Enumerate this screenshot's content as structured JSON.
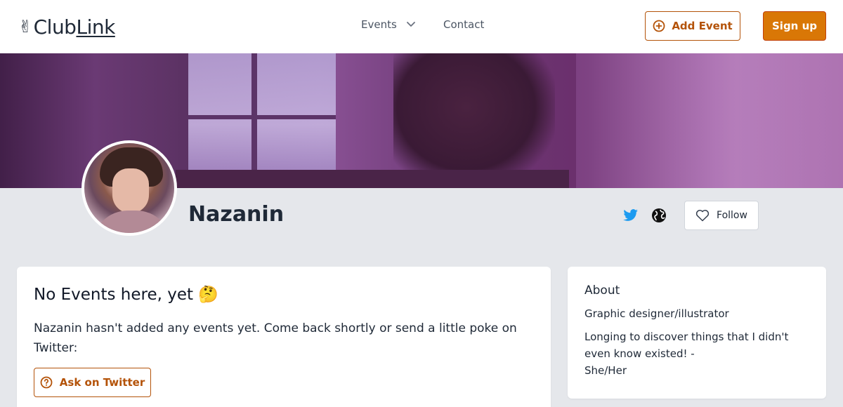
{
  "header": {
    "logo_prefix": "Club",
    "logo_suffix": "Link",
    "logo_icon": "victory-hand-emoji",
    "nav": {
      "events_label": "Events",
      "contact_label": "Contact"
    },
    "add_event_label": "Add Event",
    "signup_label": "Sign up"
  },
  "colors": {
    "accent": "#d97706",
    "accent_dark": "#b45309",
    "twitter": "#1d9bf0",
    "page_bg": "#e5e7eb"
  },
  "profile": {
    "name": "Nazanin",
    "follow_label": "Follow",
    "icons": [
      "twitter-icon",
      "globe-icon",
      "heart-icon"
    ]
  },
  "events_card": {
    "title": "No Events here, yet",
    "title_emoji": "🤔",
    "message": "Nazanin hasn't added any events yet. Come back shortly or send a little poke on Twitter:",
    "ask_label": "Ask on Twitter"
  },
  "about": {
    "title": "About",
    "role": "Graphic designer/illustrator",
    "bio": "Longing to discover things that I didn't even know existed! -\nShe/Her"
  }
}
